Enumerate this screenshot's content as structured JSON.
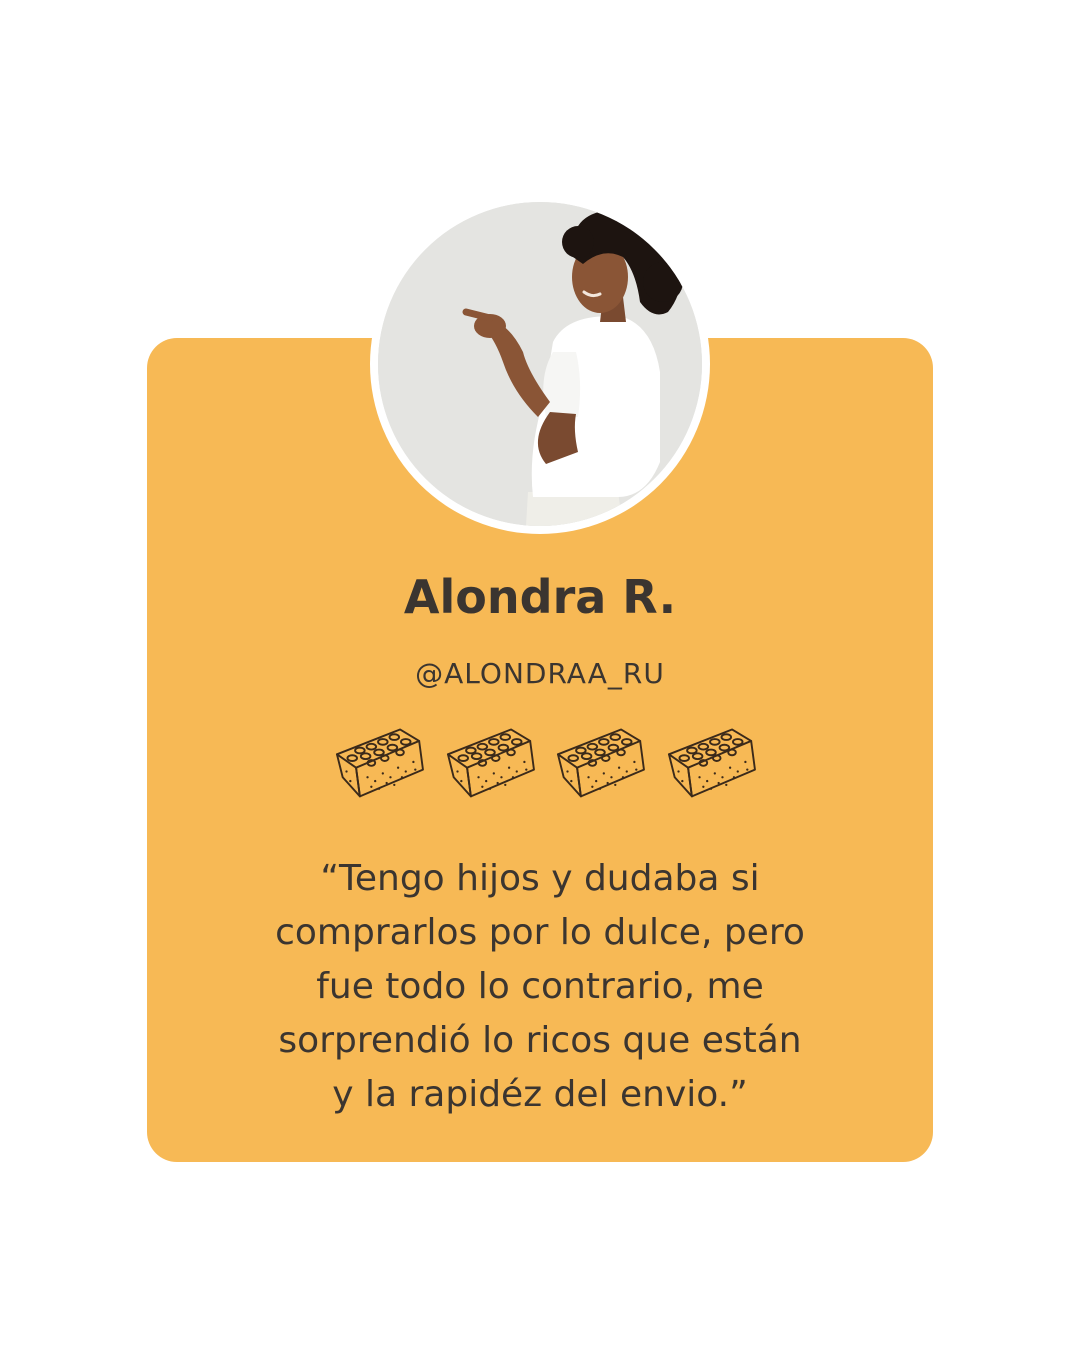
{
  "review": {
    "name": "Alondra R.",
    "handle": "@ALONDRAA_RU",
    "rating": 4,
    "rating_icon": "granola-bar-icon",
    "quote": "“Tengo hijos y dudaba si\ncomprarlos por lo dulce, pero\nfue todo lo contrario, me\nsorprendió lo ricos que están\ny la rapidéz del envio.”"
  },
  "colors": {
    "background": "#ffffff",
    "card": "#f7b955",
    "text": "#3b3530",
    "icon_stroke": "#3b2a1a"
  }
}
